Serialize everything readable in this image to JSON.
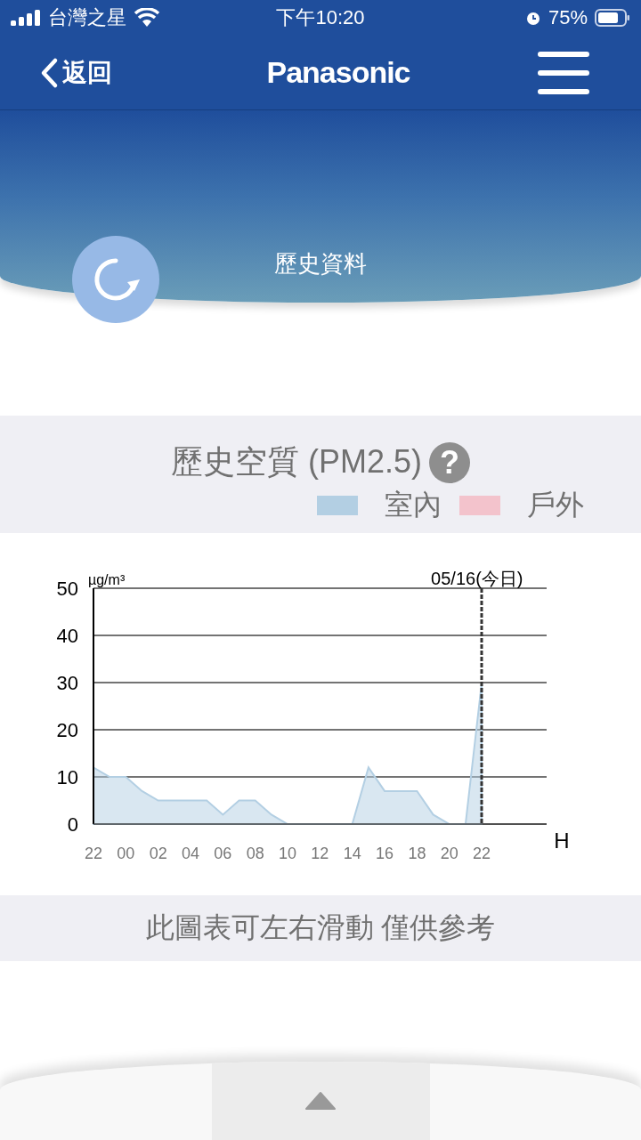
{
  "status_bar": {
    "carrier": "台灣之星",
    "time": "下午10:20",
    "battery": "75%"
  },
  "nav": {
    "back": "返回",
    "logo": "Panasonic"
  },
  "hero": {
    "title": "歷史資料"
  },
  "section": {
    "title": "歷史空質 (PM2.5)",
    "help": "?",
    "legend": [
      {
        "label": "室內",
        "color": "#b3cfe3"
      },
      {
        "label": "戶外",
        "color": "#f3c3cc"
      }
    ]
  },
  "chart": {
    "chart_data": {
      "type": "area",
      "ylabel": "µg/m³",
      "xlabel": "H",
      "grid": true,
      "categories": [
        "22",
        null,
        "00",
        null,
        "02",
        null,
        "04",
        null,
        "06",
        null,
        "08",
        null,
        "10",
        null,
        "12",
        null,
        "14",
        null,
        "16",
        null,
        "18",
        null,
        "20",
        null,
        "22"
      ],
      "series": [
        {
          "color": "#b3cfe3",
          "values": [
            12,
            10,
            10,
            7,
            5,
            5,
            5,
            5,
            2,
            5,
            5,
            2,
            0,
            0,
            0,
            0,
            0,
            12,
            7,
            7,
            7,
            2,
            0,
            0,
            30
          ]
        }
      ],
      "ylim": [
        0,
        50
      ],
      "yticks": [
        0,
        10,
        20,
        30,
        40,
        50
      ],
      "annotations": [
        "05/16(今日)"
      ]
    }
  },
  "note": "此圖表可左右滑動 僅供參考"
}
